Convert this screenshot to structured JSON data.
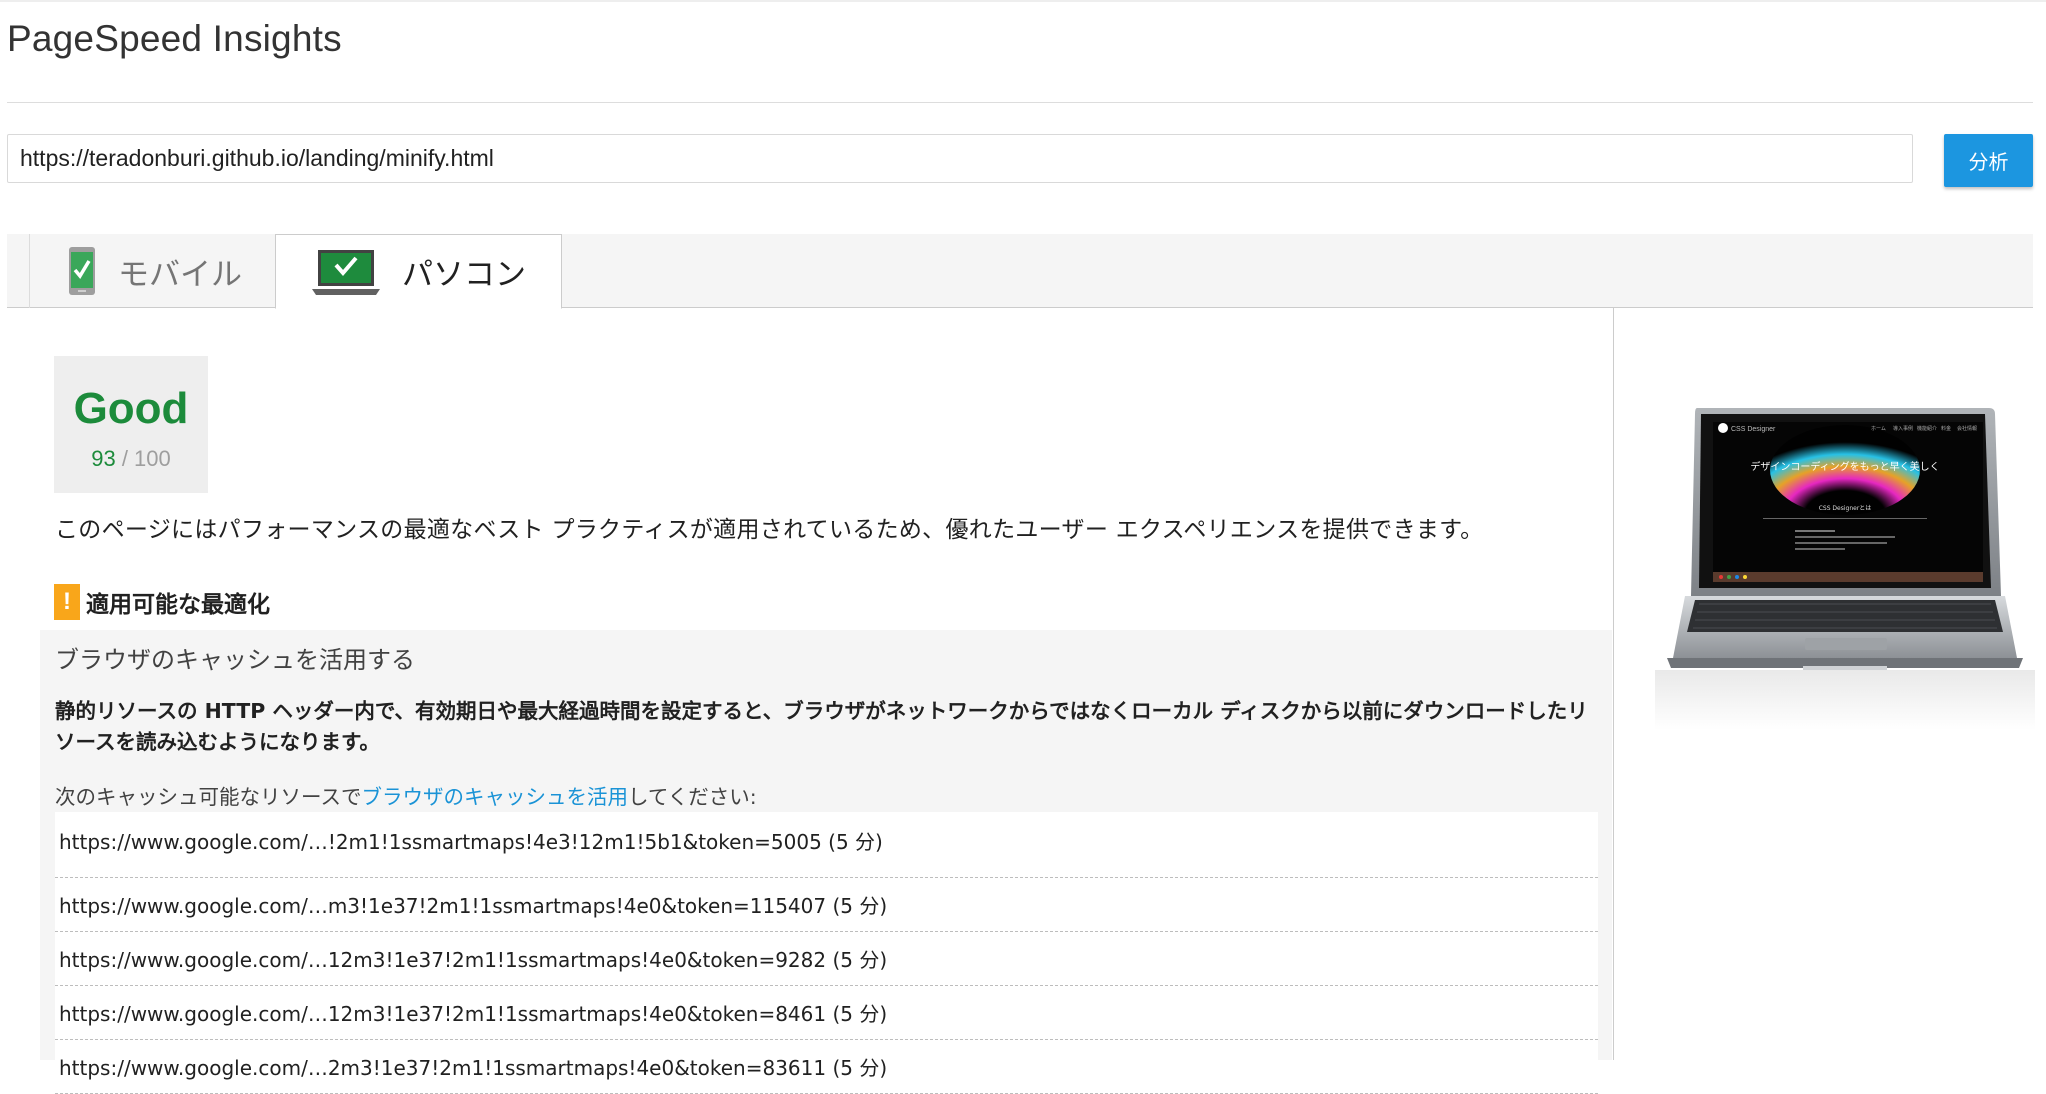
{
  "app": {
    "title": "PageSpeed Insights"
  },
  "search": {
    "url_value": "https://teradonburi.github.io/landing/minify.html",
    "analyze_label": "分析"
  },
  "tabs": [
    {
      "label": "モバイル",
      "icon": "mobile-phone-check-icon",
      "active": false
    },
    {
      "label": "パソコン",
      "icon": "laptop-check-icon",
      "active": true
    }
  ],
  "score": {
    "grade": "Good",
    "value": "93",
    "max": "/ 100",
    "color": "#1c8b3b"
  },
  "summary": "このページにはパフォーマンスの最適なベスト プラクティスが適用されているため、優れたユーザー エクスペリエンスを提供できます。",
  "section": {
    "icon": "warning-icon",
    "icon_symbol": "!",
    "title": "適用可能な最適化",
    "icon_color": "#f9a61a"
  },
  "rule": {
    "title": "ブラウザのキャッシュを活用する",
    "description": "静的リソースの HTTP ヘッダー内で、有効期日や最大経過時間を設定すると、ブラウザがネットワークからではなくローカル ディスクから以前にダウンロードしたリソースを読み込むようになります。",
    "hint_prefix": "次のキャッシュ可能なリソースで",
    "hint_link": "ブラウザのキャッシュを活用",
    "hint_suffix": "してください:",
    "resources": [
      "https://www.google.com/…!2m1!1ssmartmaps!4e3!12m1!5b1&token=5005 (5 分)",
      "https://www.google.com/…m3!1e37!2m1!1ssmartmaps!4e0&token=115407 (5 分)",
      "https://www.google.com/…12m3!1e37!2m1!1ssmartmaps!4e0&token=9282 (5 分)",
      "https://www.google.com/…12m3!1e37!2m1!1ssmartmaps!4e0&token=8461 (5 分)",
      "https://www.google.com/…2m3!1e37!2m1!1ssmartmaps!4e0&token=83611 (5 分)"
    ]
  },
  "preview": {
    "icon": "laptop-preview-image",
    "brand": "CSS Designer",
    "headline": "デザインコーディングをもっと早く美しく",
    "subheading": "CSS Designerとは",
    "nav": [
      "ホーム",
      "導入事例",
      "機能紹介",
      "料金",
      "会社情報"
    ]
  }
}
